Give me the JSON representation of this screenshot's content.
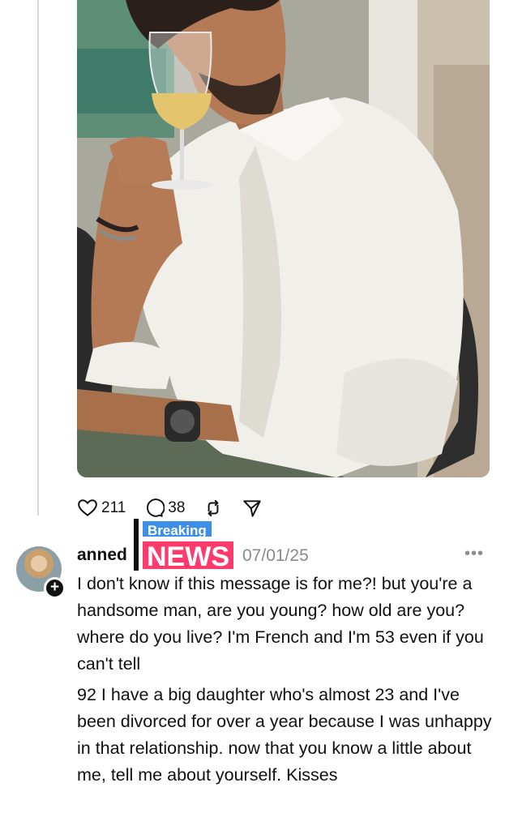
{
  "post": {
    "stats": {
      "likes": "211",
      "comments": "38"
    },
    "icons": [
      "heart-icon",
      "comment-icon",
      "repost-icon",
      "share-icon"
    ]
  },
  "reply": {
    "username": "anned",
    "date": "07/01/25",
    "more": "•••",
    "avatar_plus": "+",
    "sticker": {
      "top": "Breaking",
      "bottom": "NEWS"
    },
    "paragraph1": "I don't know if this message is for me?! but you're a handsome man, are you young? how old are you? where do you live? I'm French and I'm 53 even if you can't tell",
    "paragraph2": "92 I have a big daughter who's almost 23 and I've been divorced for over a year because I was unhappy in that relationship. now that you know a little about me, tell me about yourself. Kisses"
  },
  "colors": {
    "breaking_bg": "#3d8ee6",
    "news_bg": "#ff3b6e",
    "muted": "#8a8a8a"
  }
}
